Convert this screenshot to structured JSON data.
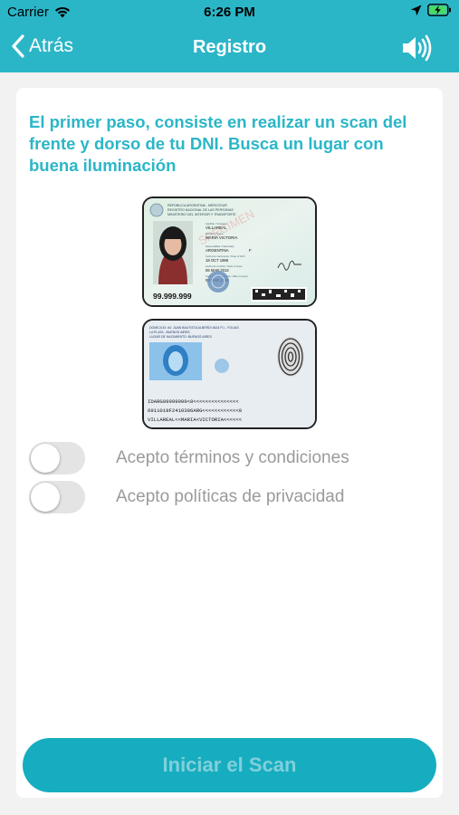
{
  "status": {
    "carrier": "Carrier",
    "time": "6:26 PM"
  },
  "nav": {
    "back_label": "Atrás",
    "title": "Registro"
  },
  "intro_text": "El primer paso, consiste en realizar un scan del frente y dorso de tu DNI. Busca un lugar con buena iluminación",
  "dni_front": {
    "header_lines": [
      "REPÚBLICA ARGENTINA - MERCOSUR",
      "REGISTRO NACIONAL DE LAS PERSONAS",
      "MINISTERIO DEL INTERIOR Y TRANSPORTE"
    ],
    "fields": [
      {
        "label": "Apellido / Surname",
        "value": "VILLAREAL"
      },
      {
        "label": "Nombre / Name",
        "value": "MARIA VICTORIA"
      },
      {
        "label": "Nacionalidad / Nationality",
        "value": "ARGENTINA"
      },
      {
        "label": "Fecha de nacimiento / Date of birth",
        "value": "18 OCT 1986"
      },
      {
        "label": "Fecha de emisión / Date of issue",
        "value": "06 MAR 2013"
      },
      {
        "label": "Fecha de vencimiento / Date of expiry",
        "value": "06 MAR 2028"
      }
    ],
    "sex": "F",
    "document_number": "99.999.999",
    "specimen": "SPECIMEN"
  },
  "dni_back": {
    "address_lines": [
      "DOMICILIO: AV. JUAN BAUTISTA ALBERDI 4624 P.1 - FOLIAS",
      "LA PLATA - BUENOS AIRES",
      "LUGAR DE NACIMIENTO: BUENOS AIRES"
    ],
    "mrz": [
      "IDARG99999999<8<<<<<<<<<<<<<<<",
      "6911018F2410306ARG<<<<<<<<<<<<0",
      "VILLAREAL<<MARIA<VICTORIA<<<<<<"
    ]
  },
  "toggles": [
    {
      "label": "Acepto términos y condiciones",
      "checked": false
    },
    {
      "label": "Acepto políticas de privacidad",
      "checked": false
    }
  ],
  "scan_button": {
    "label": "Iniciar el Scan",
    "enabled": false
  },
  "colors": {
    "brand": "#2bb6c8",
    "button": "#17adc0",
    "button_text_disabled": "#80d0db",
    "label_gray": "#9a9a9a"
  },
  "icons": [
    "wifi-icon",
    "location-arrow-icon",
    "battery-charging-icon",
    "chevron-left-icon",
    "speaker-icon"
  ]
}
